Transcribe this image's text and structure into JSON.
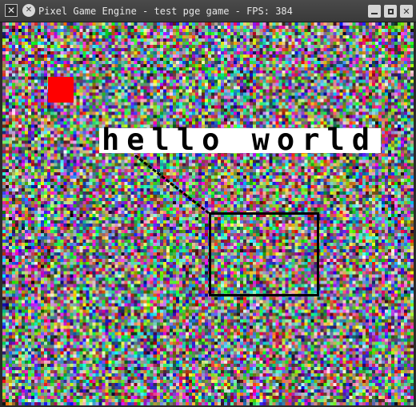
{
  "window": {
    "title": "Pixel Game Engine - test pge game - FPS: 384",
    "app_icon": "app-icon",
    "pin_icon": "pin-icon",
    "buttons": [
      "minimize",
      "maximize",
      "close"
    ]
  },
  "scene": {
    "text": "hello world",
    "text_color": "#000000",
    "text_bg_color": "#ffffff",
    "square_color": "#ff0000",
    "outline_color": "#000000",
    "background": "random-color-noise"
  }
}
